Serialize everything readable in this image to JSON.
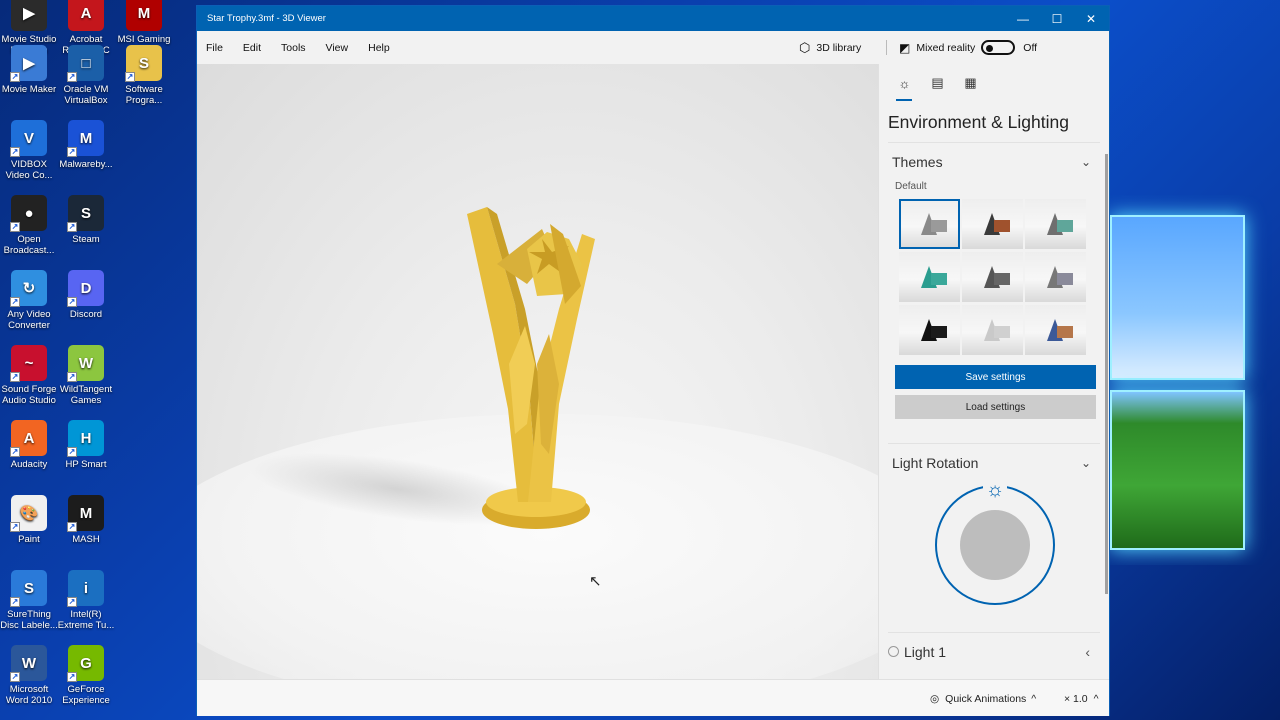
{
  "desktop": {
    "icons": [
      {
        "label": "Movie Studio Platinum 13...",
        "color": "#2b2b2b",
        "glyph": "▶"
      },
      {
        "label": "Acrobat Reader DC",
        "color": "#c4161c",
        "glyph": "A"
      },
      {
        "label": "MSI Gaming APP",
        "color": "#b00000",
        "glyph": "M"
      },
      {
        "label": "Movie Maker",
        "color": "#3a7bd5",
        "glyph": "▶"
      },
      {
        "label": "Oracle VM VirtualBox",
        "color": "#1b5fa8",
        "glyph": "□"
      },
      {
        "label": "Software Progra...",
        "color": "#e8c24a",
        "glyph": "S"
      },
      {
        "label": "VIDBOX Video Co...",
        "color": "#1e6fd9",
        "glyph": "V"
      },
      {
        "label": "Malwareby...",
        "color": "#1a52d6",
        "glyph": "M"
      },
      {
        "label": "Open Broadcast...",
        "color": "#222222",
        "glyph": "●"
      },
      {
        "label": "Steam",
        "color": "#1b2838",
        "glyph": "S"
      },
      {
        "label": "Any Video Converter",
        "color": "#2f8fe0",
        "glyph": "↻"
      },
      {
        "label": "Discord",
        "color": "#5865f2",
        "glyph": "D"
      },
      {
        "label": "Sound Forge Audio Studio",
        "color": "#c8102e",
        "glyph": "~"
      },
      {
        "label": "WildTangent Games",
        "color": "#8cc63f",
        "glyph": "W"
      },
      {
        "label": "Audacity",
        "color": "#f26522",
        "glyph": "A"
      },
      {
        "label": "HP Smart",
        "color": "#0096d6",
        "glyph": "H"
      },
      {
        "label": "Paint",
        "color": "#f0f0f0",
        "glyph": "🎨"
      },
      {
        "label": "MASH",
        "color": "#1c1c1c",
        "glyph": "M"
      },
      {
        "label": "SureThing Disc Labele...",
        "color": "#2a7ad9",
        "glyph": "S"
      },
      {
        "label": "Intel(R) Extreme Tu...",
        "color": "#1b6fc1",
        "glyph": "i"
      },
      {
        "label": "Microsoft Word 2010",
        "color": "#2b579a",
        "glyph": "W"
      },
      {
        "label": "GeForce Experience",
        "color": "#76b900",
        "glyph": "G"
      }
    ]
  },
  "window": {
    "title": "Star Trophy.3mf - 3D Viewer",
    "controls": {
      "minimize": "—",
      "maximize": "☐",
      "close": "✕"
    }
  },
  "menu": {
    "items": [
      "File",
      "Edit",
      "Tools",
      "View",
      "Help"
    ],
    "library_label": "3D library",
    "mixed_reality_label": "Mixed reality",
    "mixed_reality_state": "Off"
  },
  "panel": {
    "title": "Environment & Lighting",
    "themes": {
      "heading": "Themes",
      "default_label": "Default",
      "thumbs": [
        {
          "cone": "#8a8a8a",
          "box": "#9a9a9a"
        },
        {
          "cone": "#3a3a3a",
          "box": "#a0522d"
        },
        {
          "cone": "#6f6f6f",
          "box": "#5fa69a"
        },
        {
          "cone": "#2a9d8f",
          "box": "#3aa89a"
        },
        {
          "cone": "#555555",
          "box": "#666666"
        },
        {
          "cone": "#777777",
          "box": "#8a8a9a"
        },
        {
          "cone": "#111111",
          "box": "#1a1a1a"
        },
        {
          "cone": "#c9c9c9",
          "box": "#d0d0d0"
        },
        {
          "cone": "#3b5998",
          "box": "#b5764a"
        }
      ]
    },
    "save_label": "Save settings",
    "load_label": "Load settings",
    "light_rotation": {
      "heading": "Light Rotation"
    },
    "light1_label": "Light 1"
  },
  "status": {
    "quick_animations": "Quick Animations",
    "speed": "× 1.0"
  },
  "colors": {
    "accent": "#0063b1",
    "trophy": "#e8c24a"
  }
}
